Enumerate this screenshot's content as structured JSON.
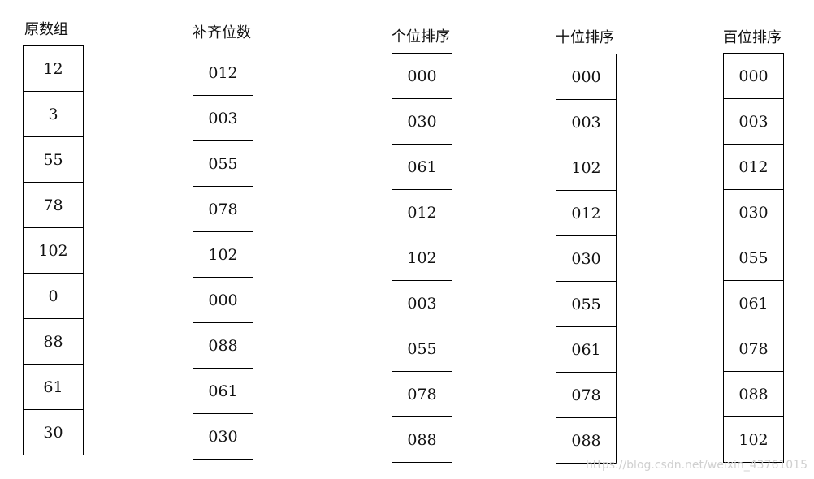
{
  "columns": [
    {
      "title": "原数组",
      "values": [
        "12",
        "3",
        "55",
        "78",
        "102",
        "0",
        "88",
        "61",
        "30"
      ]
    },
    {
      "title": "补齐位数",
      "values": [
        "012",
        "003",
        "055",
        "078",
        "102",
        "000",
        "088",
        "061",
        "030"
      ]
    },
    {
      "title": "个位排序",
      "values": [
        "000",
        "030",
        "061",
        "012",
        "102",
        "003",
        "055",
        "078",
        "088"
      ]
    },
    {
      "title": "十位排序",
      "values": [
        "000",
        "003",
        "102",
        "012",
        "030",
        "055",
        "061",
        "078",
        "088"
      ]
    },
    {
      "title": "百位排序",
      "values": [
        "000",
        "003",
        "012",
        "030",
        "055",
        "061",
        "078",
        "088",
        "102"
      ]
    }
  ],
  "watermark": "https://blog.csdn.net/weixin_43761015"
}
